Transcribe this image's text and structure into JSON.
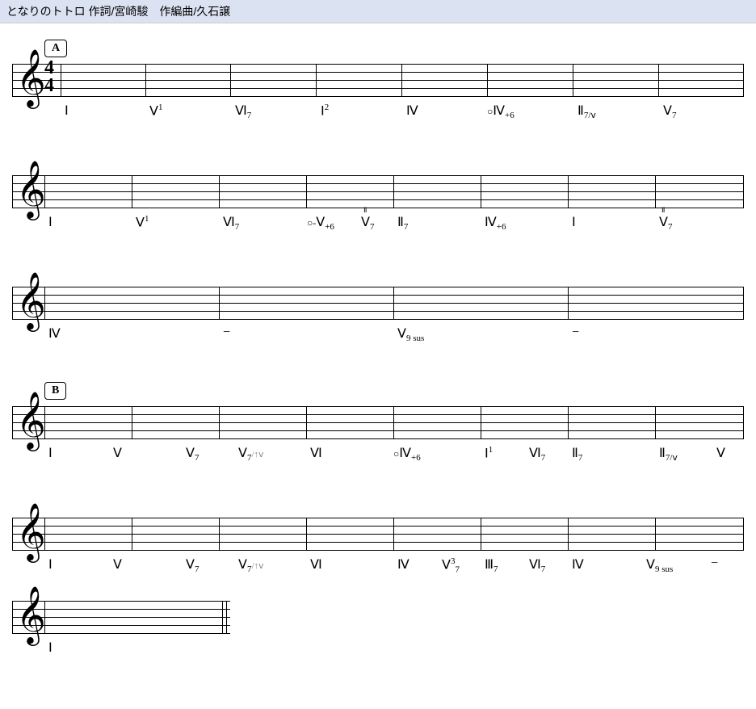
{
  "title": "となりのトトロ 作詞/宮崎駿　作編曲/久石譲",
  "rehearsal_a": "A",
  "rehearsal_b": "B",
  "ts_n": "4",
  "ts_d": "4",
  "s1": {
    "c1": {
      "r": "Ⅰ"
    },
    "c2": {
      "r": "Ⅴ",
      "sup": "1"
    },
    "c3": {
      "r": "Ⅵ",
      "sub": "7"
    },
    "c4": {
      "r": "Ⅰ",
      "sup": "2"
    },
    "c5": {
      "r": "Ⅳ"
    },
    "c6": {
      "p": "○",
      "r": "Ⅳ",
      "sub": "+6"
    },
    "c7": {
      "r": "Ⅱ",
      "sub": "7/ⅴ"
    },
    "c8": {
      "r": "Ⅴ",
      "sub": "7"
    }
  },
  "s2": {
    "c1": {
      "r": "Ⅰ"
    },
    "c2": {
      "r": "Ⅴ",
      "sup": "1"
    },
    "c3": {
      "r": "Ⅵ",
      "sub": "7"
    },
    "c4a": {
      "p": "○-",
      "r": "Ⅴ",
      "sub": "+6"
    },
    "c4b": {
      "r": "Ⅴ",
      "sub": "7",
      "top": "Ⅱ"
    },
    "c5": {
      "r": "Ⅱ",
      "sub": "7"
    },
    "c6": {
      "r": "Ⅳ",
      "sub": "+6"
    },
    "c7": {
      "r": "Ⅰ"
    },
    "c8": {
      "r": "Ⅴ",
      "sub": "7",
      "top": "Ⅱ"
    }
  },
  "s3": {
    "c1": {
      "r": "Ⅳ"
    },
    "c2": {
      "r": "−"
    },
    "c3": {
      "r": "Ⅴ",
      "sub": "9 sus"
    },
    "c4": {
      "r": "−"
    }
  },
  "s4": {
    "c1": {
      "r": "Ⅰ"
    },
    "c2": {
      "r": "Ⅴ"
    },
    "c3": {
      "r": "Ⅴ",
      "sub": "7"
    },
    "c4": {
      "r": "Ⅴ",
      "sub": "7",
      "sfx": "/↑ⅴ"
    },
    "c5": {
      "r": "Ⅵ"
    },
    "c6": {
      "p": "○",
      "r": "Ⅳ",
      "sub": "+6"
    },
    "c7": {
      "r": "Ⅰ",
      "sup": "1"
    },
    "c8": {
      "r": "Ⅵ",
      "sub": "7"
    },
    "c9": {
      "r": "Ⅱ",
      "sub": "7"
    },
    "c10": {
      "r": "Ⅱ",
      "sub": "7/ⅴ"
    },
    "c11": {
      "r": "Ⅴ"
    }
  },
  "s5": {
    "c1": {
      "r": "Ⅰ"
    },
    "c2": {
      "r": "Ⅴ"
    },
    "c3": {
      "r": "Ⅴ",
      "sub": "7"
    },
    "c4": {
      "r": "Ⅴ",
      "sub": "7",
      "sfx": "/↑ⅴ"
    },
    "c5": {
      "r": "Ⅵ"
    },
    "c6": {
      "r": "Ⅳ"
    },
    "c7": {
      "r": "Ⅴ",
      "sub": "7",
      "sup": "3"
    },
    "c8": {
      "r": "Ⅲ",
      "sub": "7"
    },
    "c9": {
      "r": "Ⅵ",
      "sub": "7"
    },
    "c10": {
      "r": "Ⅳ"
    },
    "c11": {
      "r": "Ⅴ",
      "sub": "9 sus"
    },
    "c12": {
      "r": "−"
    }
  },
  "s6": {
    "c1": {
      "r": "Ⅰ"
    }
  }
}
